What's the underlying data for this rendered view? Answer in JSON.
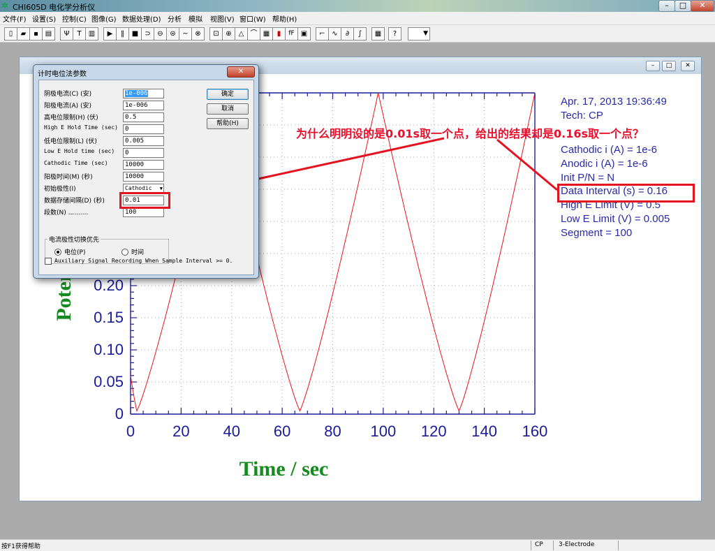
{
  "app": {
    "title": "CHI605D 电化学分析仪",
    "window_buttons": [
      "–",
      "□",
      "✕"
    ]
  },
  "menu": [
    "文件(F)",
    "设置(S)",
    "控制(C)",
    "图像(G)",
    "数据处理(D)",
    "分析",
    "模拟",
    "视图(V)",
    "窗口(W)",
    "帮助(H)"
  ],
  "toolbar_icons": [
    "new-icon",
    "open-icon",
    "save-icon",
    "print-icon",
    "symbol-icon",
    "text-icon",
    "table-icon",
    "run-icon",
    "pause-icon",
    "stop-icon",
    "reverse-icon",
    "purge-icon",
    "stir-icon",
    "filter-icon",
    "cell-icon",
    "graph-icon",
    "zoom-icon",
    "peak-icon",
    "smooth-icon",
    "calibrate-icon",
    "color-icon",
    "font-icon",
    "copy-icon",
    "tech-icon",
    "wave-icon",
    "deriv-icon",
    "integrate-icon",
    "grid-icon",
    "help-icon"
  ],
  "doc_window": {
    "buttons": [
      "–",
      "□",
      "✕"
    ]
  },
  "chart_data": {
    "type": "line",
    "xlabel": "Time / sec",
    "ylabel": "Poten",
    "xlim": [
      0,
      160
    ],
    "ylim": [
      0,
      0.5
    ],
    "x_ticks": [
      "0",
      "20",
      "40",
      "60",
      "80",
      "100",
      "120",
      "140",
      "160"
    ],
    "y_ticks": [
      "0",
      "0.05",
      "0.10",
      "0.15",
      "0.20"
    ],
    "series": [
      {
        "color": "#e8141e",
        "x": [
          0,
          2.5,
          35,
          67,
          98,
          130,
          160
        ],
        "y": [
          0.06,
          0.005,
          0.5,
          0.005,
          0.5,
          0.005,
          0.5
        ]
      }
    ],
    "grid": true
  },
  "info_lines": [
    "Apr. 17, 2013    19:36:49",
    "Tech: CP",
    "Cathodic i (A) = 1e-6",
    "Anodic i (A) = 1e-6",
    "Init P/N = N",
    "Data Interval (s) = 0.16",
    "High E Limit (V) = 0.5",
    "Low E Limit (V) = 0.005",
    "Segment = 100"
  ],
  "annotation": {
    "question": "为什么明明设的是0.01s取一个点，给出的结果却是0.16s取一个点？",
    "color": "#e4131f"
  },
  "dialog": {
    "title": "计时电位法参数",
    "close": "✕",
    "fields": [
      {
        "label": "阴极电流(C) (安)",
        "value": "1e-006"
      },
      {
        "label": "阳极电流(A) (安)",
        "value": "1e-006"
      },
      {
        "label": "高电位限制(H) (伏)",
        "value": "0.5"
      },
      {
        "label": "High E Hold Time (sec)",
        "value": "0"
      },
      {
        "label": "低电位限制(L) (伏)",
        "value": "0.005"
      },
      {
        "label": "Low E Hold time (sec)",
        "value": "0"
      },
      {
        "label": "Cathodic Time (sec)",
        "value": "10000"
      },
      {
        "label": "阳极时间(M) (秒)",
        "value": "10000"
      },
      {
        "label": "初始极性(I)",
        "value": "Cathodic"
      },
      {
        "label": "数据存储间隔(D) (秒)",
        "value": "0.01"
      },
      {
        "label": "段数(N) ..........",
        "value": "100"
      }
    ],
    "buttons": {
      "ok": "确定",
      "cancel": "取消",
      "help": "帮助(H)"
    },
    "group_title": "电流极性切换优先",
    "radio_potential": "电位(P)",
    "radio_time": "时间",
    "aux_checkbox": "Auxiliary Signal Recording When Sample Interval >= 0."
  },
  "status": {
    "help": "按F1获得帮助",
    "tech": "CP",
    "electrode": "3-Electrode"
  }
}
